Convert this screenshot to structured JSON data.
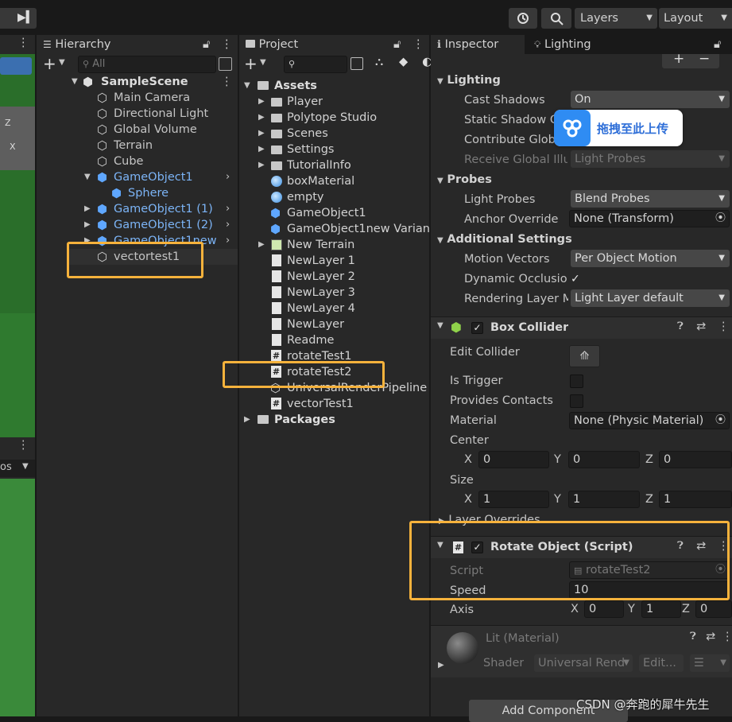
{
  "toolbar": {
    "history_icon": "history-icon",
    "search_icon": "search-icon",
    "layers_label": "Layers",
    "layout_label": "Layout"
  },
  "hierarchy": {
    "tab_label": "Hierarchy",
    "search_placeholder": "All",
    "scene_name": "SampleScene",
    "items": [
      {
        "label": "Main Camera",
        "blue": false
      },
      {
        "label": "Directional Light",
        "blue": false
      },
      {
        "label": "Global Volume",
        "blue": false
      },
      {
        "label": "Terrain",
        "blue": false
      },
      {
        "label": "Cube",
        "blue": false
      },
      {
        "label": "GameObject1",
        "blue": true
      },
      {
        "label": "Sphere",
        "blue": true
      },
      {
        "label": "GameObject1 (1)",
        "blue": true
      },
      {
        "label": "GameObject1 (2)",
        "blue": true
      },
      {
        "label": "GameObject1new",
        "blue": true
      },
      {
        "label": "vectortest1",
        "blue": false
      }
    ]
  },
  "project": {
    "tab_label": "Project",
    "assets_label": "Assets",
    "items": [
      "Player",
      "Polytope Studio",
      "Scenes",
      "Settings",
      "TutorialInfo",
      "boxMaterial",
      "empty",
      "GameObject1",
      "GameObject1new Varian",
      "New Terrain",
      "NewLayer 1",
      "NewLayer 2",
      "NewLayer 3",
      "NewLayer 4",
      "NewLayer",
      "Readme",
      "rotateTest1",
      "rotateTest2",
      "UniversalRenderPipeline",
      "vectorTest1"
    ],
    "packages_label": "Packages"
  },
  "inspector": {
    "tab_label": "Inspector",
    "lighting_tab_label": "Lighting",
    "lighting_section": "Lighting",
    "cast_shadows_label": "Cast Shadows",
    "cast_shadows_value": "On",
    "static_shadow_label": "Static Shadow C",
    "contribute_label": "Contribute Globa",
    "receive_label": "Receive Global Illu",
    "receive_value": "Light Probes",
    "probes_section": "Probes",
    "light_probes_label": "Light Probes",
    "light_probes_value": "Blend Probes",
    "anchor_label": "Anchor Override",
    "anchor_value": "None (Transform)",
    "additional_section": "Additional Settings",
    "motion_label": "Motion Vectors",
    "motion_value": "Per Object Motion",
    "dynamic_label": "Dynamic Occlusio",
    "rendering_label": "Rendering Layer M",
    "rendering_value": "Light Layer default",
    "box_collider_title": "Box Collider",
    "edit_collider_label": "Edit Collider",
    "is_trigger_label": "Is Trigger",
    "provides_label": "Provides Contacts",
    "material_label": "Material",
    "material_value": "None (Physic Material)",
    "center_label": "Center",
    "center": {
      "x": "0",
      "y": "0",
      "z": "0"
    },
    "size_label": "Size",
    "size": {
      "x": "1",
      "y": "1",
      "z": "1"
    },
    "layer_overrides_label": "Layer Overrides",
    "rotate_title": "Rotate Object (Script)",
    "script_label": "Script",
    "script_value": "rotateTest2",
    "speed_label": "Speed",
    "speed_value": "10",
    "axis_label": "Axis",
    "axis": {
      "x": "0",
      "y": "1",
      "z": "0"
    },
    "material_name": "Lit (Material)",
    "shader_label": "Shader",
    "shader_value": "Universal Rend",
    "edit_label": "Edit...",
    "add_component_label": "Add Component"
  },
  "upload_badge": "拖拽至此上传",
  "watermark": "CSDN @奔跑的犀牛先生",
  "axis_letters": {
    "x": "X",
    "y": "Y",
    "z": "Z"
  },
  "left_strip_label": "os"
}
